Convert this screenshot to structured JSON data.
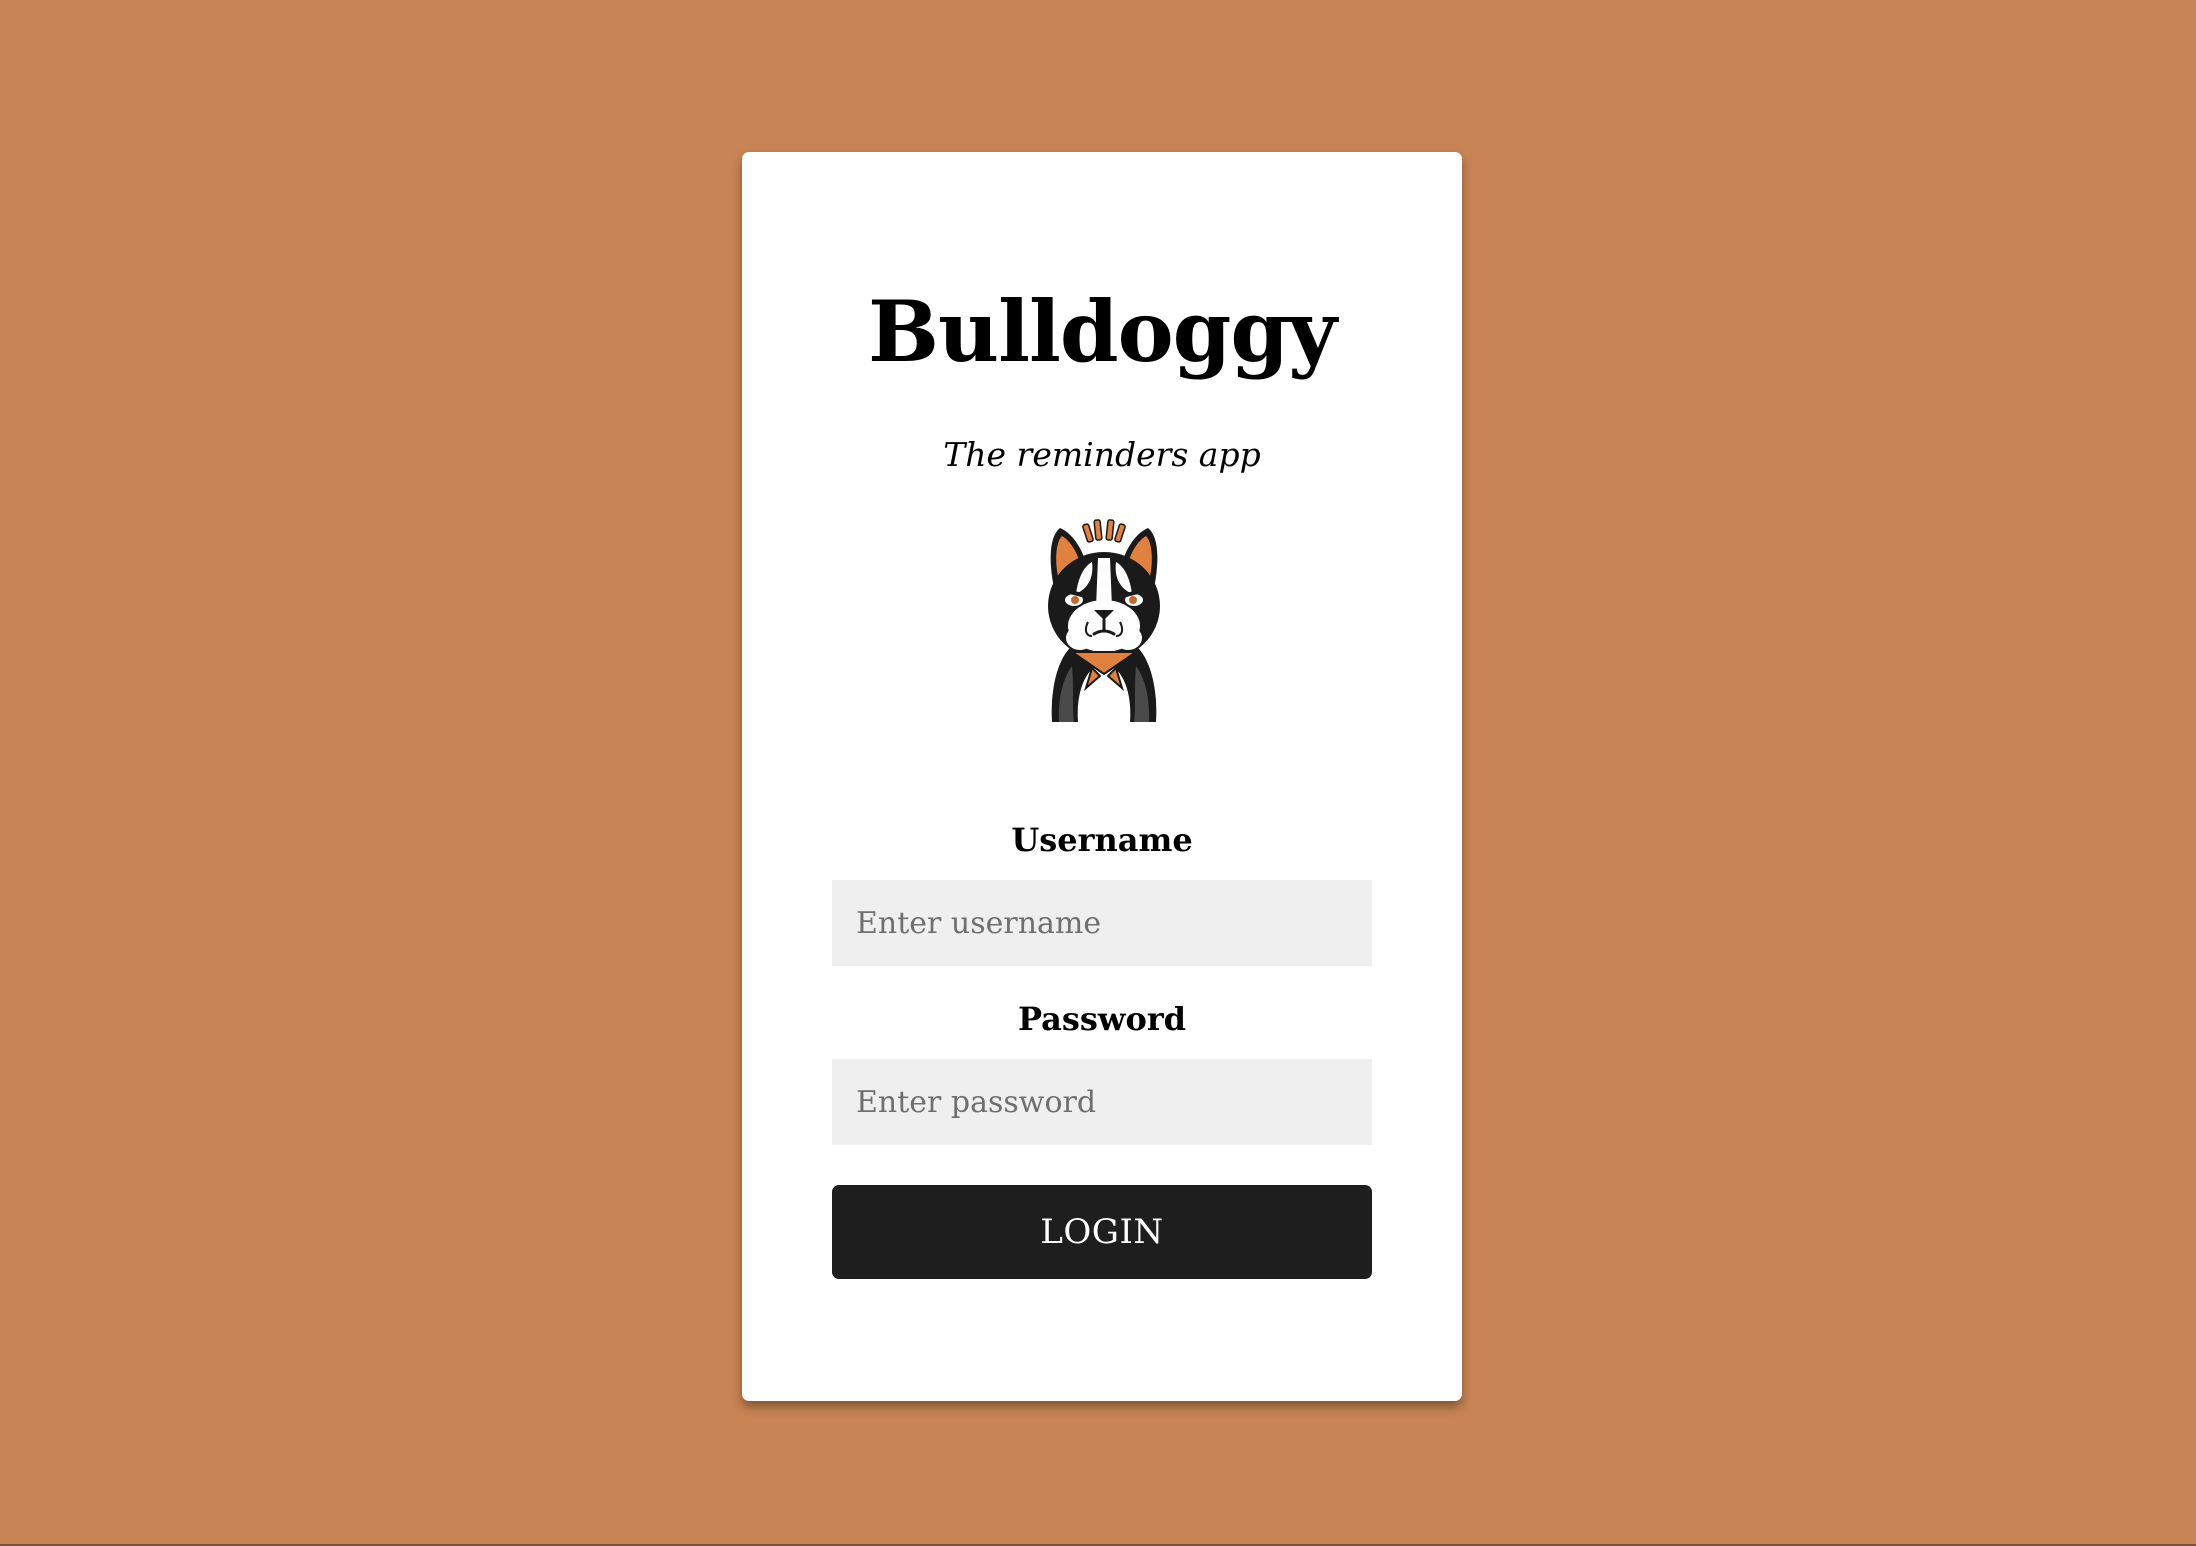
{
  "app": {
    "title": "Bulldoggy",
    "subtitle": "The reminders app",
    "logo_icon": "bulldog-mascot-icon"
  },
  "form": {
    "username_label": "Username",
    "username_placeholder": "Enter username",
    "username_value": "",
    "password_label": "Password",
    "password_placeholder": "Enter password",
    "password_value": "",
    "login_label": "LOGIN"
  },
  "colors": {
    "background": "#c88454",
    "card": "#ffffff",
    "input_background": "#efefef",
    "button": "#1e1e1e",
    "accent_orange": "#e0813f"
  }
}
